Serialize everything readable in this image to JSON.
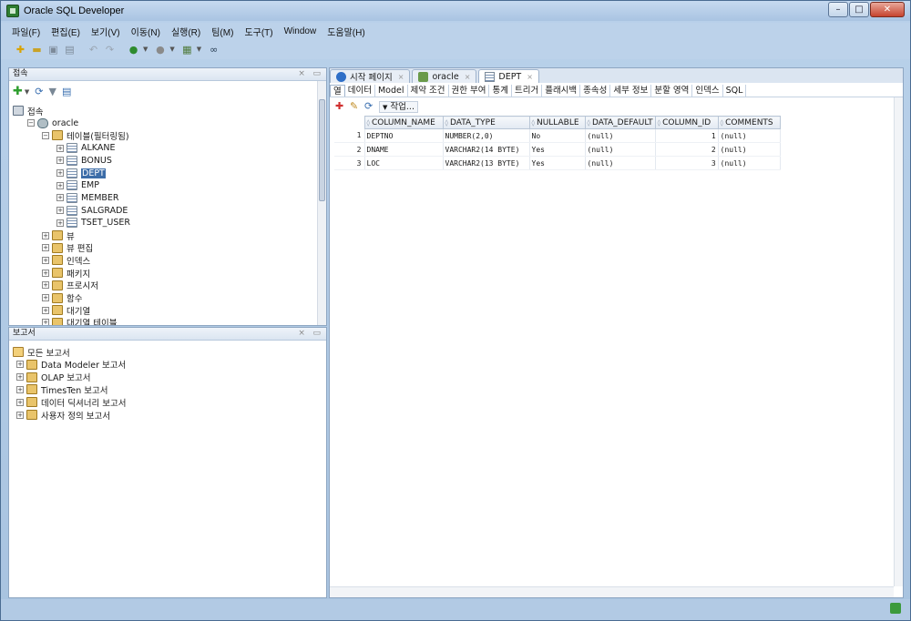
{
  "window": {
    "title": "Oracle SQL Developer"
  },
  "menu": [
    "파일(F)",
    "편집(E)",
    "보기(V)",
    "이동(N)",
    "실행(R)",
    "팀(M)",
    "도구(T)",
    "Window",
    "도움말(H)"
  ],
  "connections_panel": {
    "title": "접속",
    "tree": [
      {
        "label": "접속",
        "icon": "connections-icon",
        "level": 0
      },
      {
        "label": "oracle",
        "icon": "database-icon",
        "level": 1
      },
      {
        "label": "테이블(필터링됨)",
        "icon": "folder-icon",
        "level": 2
      },
      {
        "label": "ALKANE",
        "icon": "table-icon",
        "level": 3
      },
      {
        "label": "BONUS",
        "icon": "table-icon",
        "level": 3
      },
      {
        "label": "DEPT",
        "icon": "table-icon",
        "level": 3,
        "selected": true
      },
      {
        "label": "EMP",
        "icon": "table-icon",
        "level": 3
      },
      {
        "label": "MEMBER",
        "icon": "table-icon",
        "level": 3
      },
      {
        "label": "SALGRADE",
        "icon": "table-icon",
        "level": 3
      },
      {
        "label": "TSET_USER",
        "icon": "table-icon",
        "level": 3
      },
      {
        "label": "뷰",
        "icon": "folder-icon",
        "level": 2
      },
      {
        "label": "뷰 편집",
        "icon": "folder-icon",
        "level": 2
      },
      {
        "label": "인덱스",
        "icon": "folder-icon",
        "level": 2
      },
      {
        "label": "패키지",
        "icon": "folder-icon",
        "level": 2
      },
      {
        "label": "프로시저",
        "icon": "folder-icon",
        "level": 2
      },
      {
        "label": "함수",
        "icon": "folder-icon",
        "level": 2
      },
      {
        "label": "대기열",
        "icon": "folder-icon",
        "level": 2
      },
      {
        "label": "대기열 테이블",
        "icon": "folder-icon",
        "level": 2
      }
    ]
  },
  "reports_panel": {
    "title": "보고서",
    "tree": [
      {
        "label": "모든 보고서",
        "level": 0
      },
      {
        "label": "Data Modeler 보고서",
        "level": 1
      },
      {
        "label": "OLAP 보고서",
        "level": 1
      },
      {
        "label": "TimesTen 보고서",
        "level": 1
      },
      {
        "label": "데이터 딕셔너리 보고서",
        "level": 1
      },
      {
        "label": "사용자 정의 보고서",
        "level": 1
      }
    ]
  },
  "editor": {
    "doc_tabs": [
      {
        "label": "시작 페이지",
        "icon": "help-icon"
      },
      {
        "label": "oracle",
        "icon": "sql-worksheet-icon"
      },
      {
        "label": "DEPT",
        "icon": "table-icon",
        "active": true
      }
    ],
    "sub_tabs": [
      "열",
      "데이터",
      "Model",
      "제약 조건",
      "권한 부여",
      "통계",
      "트리거",
      "플래시백",
      "종속성",
      "세부 정보",
      "분할 영역",
      "인덱스",
      "SQL"
    ],
    "actions_label": "작업...",
    "columns": [
      "COLUMN_NAME",
      "DATA_TYPE",
      "NULLABLE",
      "DATA_DEFAULT",
      "COLUMN_ID",
      "COMMENTS"
    ],
    "rows": [
      {
        "num": "1",
        "cells": [
          "DEPTNO",
          "NUMBER(2,0)",
          "No",
          "(null)",
          "1",
          "(null)"
        ]
      },
      {
        "num": "2",
        "cells": [
          "DNAME",
          "VARCHAR2(14 BYTE)",
          "Yes",
          "(null)",
          "2",
          "(null)"
        ]
      },
      {
        "num": "3",
        "cells": [
          "LOC",
          "VARCHAR2(13 BYTE)",
          "Yes",
          "(null)",
          "3",
          "(null)"
        ]
      }
    ]
  }
}
